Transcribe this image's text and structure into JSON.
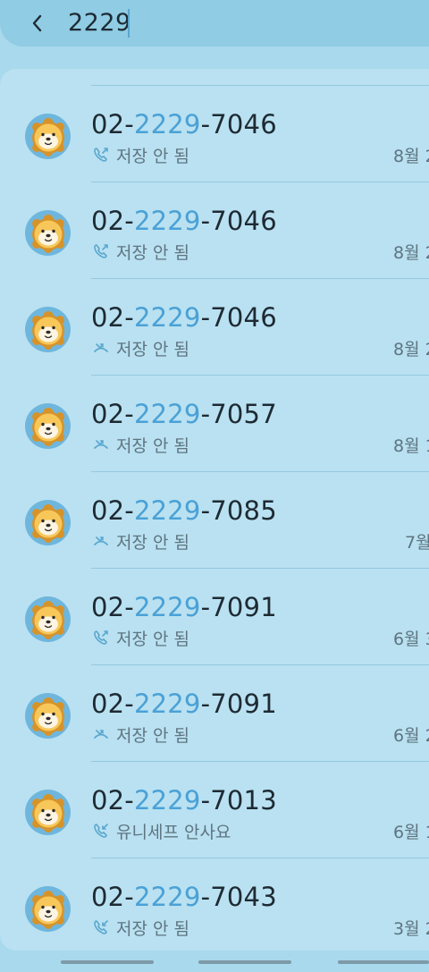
{
  "search": {
    "query": "2229",
    "back_icon": "chevron-left-icon"
  },
  "calls": [
    {
      "prefix": "02-",
      "match": "2229",
      "suffix": "-7046",
      "status": "저장 안 됨",
      "date": "8월 2",
      "call_type": "outgoing"
    },
    {
      "prefix": "02-",
      "match": "2229",
      "suffix": "-7046",
      "status": "저장 안 됨",
      "date": "8월 2",
      "call_type": "outgoing"
    },
    {
      "prefix": "02-",
      "match": "2229",
      "suffix": "-7046",
      "status": "저장 안 됨",
      "date": "8월 2",
      "call_type": "missed"
    },
    {
      "prefix": "02-",
      "match": "2229",
      "suffix": "-7057",
      "status": "저장 안 됨",
      "date": "8월 1",
      "call_type": "missed"
    },
    {
      "prefix": "02-",
      "match": "2229",
      "suffix": "-7085",
      "status": "저장 안 됨",
      "date": "7월",
      "call_type": "missed"
    },
    {
      "prefix": "02-",
      "match": "2229",
      "suffix": "-7091",
      "status": "저장 안 됨",
      "date": "6월 3",
      "call_type": "outgoing"
    },
    {
      "prefix": "02-",
      "match": "2229",
      "suffix": "-7091",
      "status": "저장 안 됨",
      "date": "6월 2",
      "call_type": "missed"
    },
    {
      "prefix": "02-",
      "match": "2229",
      "suffix": "-7013",
      "status": "유니세프 안사요",
      "date": "6월 1",
      "call_type": "incoming"
    },
    {
      "prefix": "02-",
      "match": "2229",
      "suffix": "-7043",
      "status": "저장 안 됨",
      "date": "3월 2",
      "call_type": "incoming"
    }
  ],
  "colors": {
    "highlight": "#4aa1d6",
    "background": "#a9d9ec",
    "card": "#b9e1f1"
  }
}
